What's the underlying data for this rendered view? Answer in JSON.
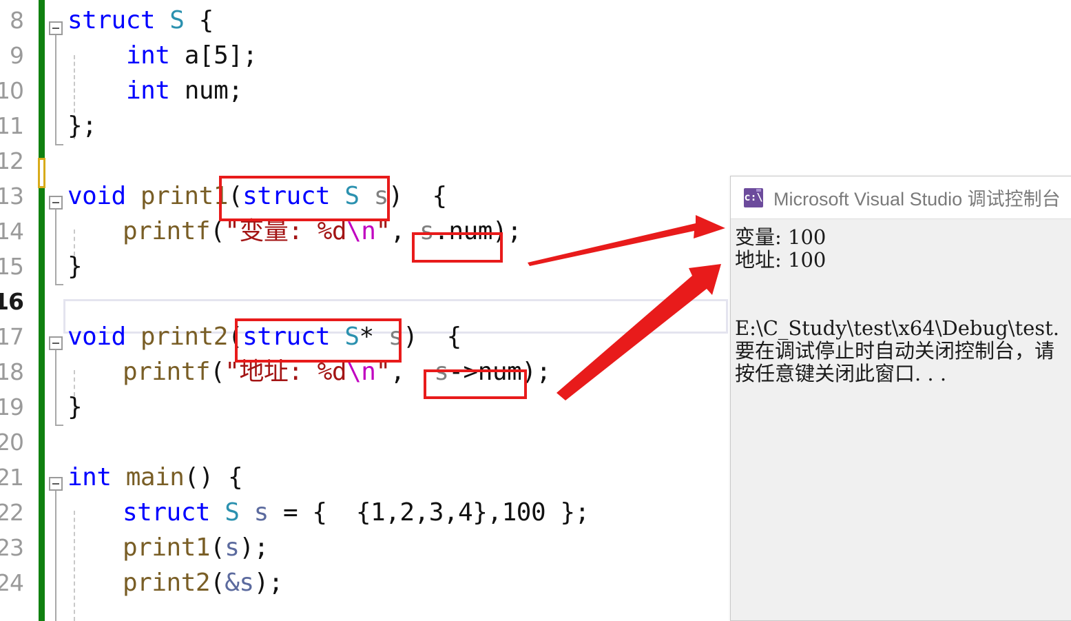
{
  "editor": {
    "language": "c",
    "gutter": {
      "line_numbers": [
        "8",
        "9",
        "10",
        "11",
        "12",
        "13",
        "14",
        "15",
        "16",
        "17",
        "18",
        "19",
        "20",
        "21",
        "22",
        "23",
        "24"
      ],
      "current_line_number": "16"
    },
    "lines": [
      {
        "n": "8",
        "text": "struct S {"
      },
      {
        "n": "9",
        "text": "    int a[5];"
      },
      {
        "n": "10",
        "text": "    int num;"
      },
      {
        "n": "11",
        "text": "};"
      },
      {
        "n": "12",
        "text": ""
      },
      {
        "n": "13",
        "text": "void print1(struct S s)  {"
      },
      {
        "n": "14",
        "text": "    printf(\"变量: %d\\n\", s.num);"
      },
      {
        "n": "15",
        "text": "}"
      },
      {
        "n": "16",
        "text": ""
      },
      {
        "n": "17",
        "text": "void print2(struct S* s)  {"
      },
      {
        "n": "18",
        "text": "    printf(\"地址: %d\\n\", s->num);"
      },
      {
        "n": "19",
        "text": "}"
      },
      {
        "n": "20",
        "text": ""
      },
      {
        "n": "21",
        "text": "int main() {"
      },
      {
        "n": "22",
        "text": "    struct S s = {  {1,2,3,4},100 };"
      },
      {
        "n": "23",
        "text": "    print1(s);"
      },
      {
        "n": "24",
        "text": "    print2(&s);"
      }
    ],
    "tokens": {
      "kw_struct": "struct",
      "kw_int": "int",
      "kw_void": "void",
      "type_S": "S",
      "fn_print1": "print1",
      "fn_print2": "print2",
      "fn_printf": "printf",
      "fn_main": "main",
      "var_s": "s",
      "member_num": "num",
      "member_a5": "a[5]",
      "str_bianliang": "\"变量: %d",
      "str_dizhi": "\"地址: %d",
      "escape_n": "\\n",
      "quote_close": "\"",
      "init_array": "{1,2,3,4}",
      "init_num": "100"
    },
    "annotations": {
      "boxes": [
        {
          "id": "box-print1-param",
          "label": "(struct S s)"
        },
        {
          "id": "box-print1-access",
          "label": "s.num)"
        },
        {
          "id": "box-print2-param",
          "label": "(struct S* s)"
        },
        {
          "id": "box-print2-access",
          "label": "s->num)"
        }
      ],
      "arrow_color": "#e81b1b",
      "box_color": "#e81b1b",
      "arrows": [
        {
          "id": "arrow-to-variable-output",
          "from": "s.num",
          "to": "变量: 100"
        },
        {
          "id": "arrow-to-address-output",
          "from": "s->num",
          "to": "地址: 100"
        }
      ]
    },
    "colors": {
      "keyword": "#0000ff",
      "type": "#2b91af",
      "function": "#795e26",
      "parameter": "#808080",
      "local_variable": "#5b6a9e",
      "string": "#a31515",
      "escape": "#c000c0",
      "change_bar_saved": "#108010",
      "change_bar_unsaved": "#d8ab1a"
    }
  },
  "console": {
    "title": "Microsoft Visual Studio 调试控制台",
    "icon": "console-cmd-icon",
    "icon_glyph": "c:\\",
    "output": [
      "变量: 100",
      "地址: 100",
      "",
      "E:\\C_Study\\test\\x64\\Debug\\test.",
      "要在调试停止时自动关闭控制台，请",
      "按任意键关闭此窗口. . ."
    ],
    "background": "#f0f0f0",
    "titlebar_background": "#ffffff"
  }
}
